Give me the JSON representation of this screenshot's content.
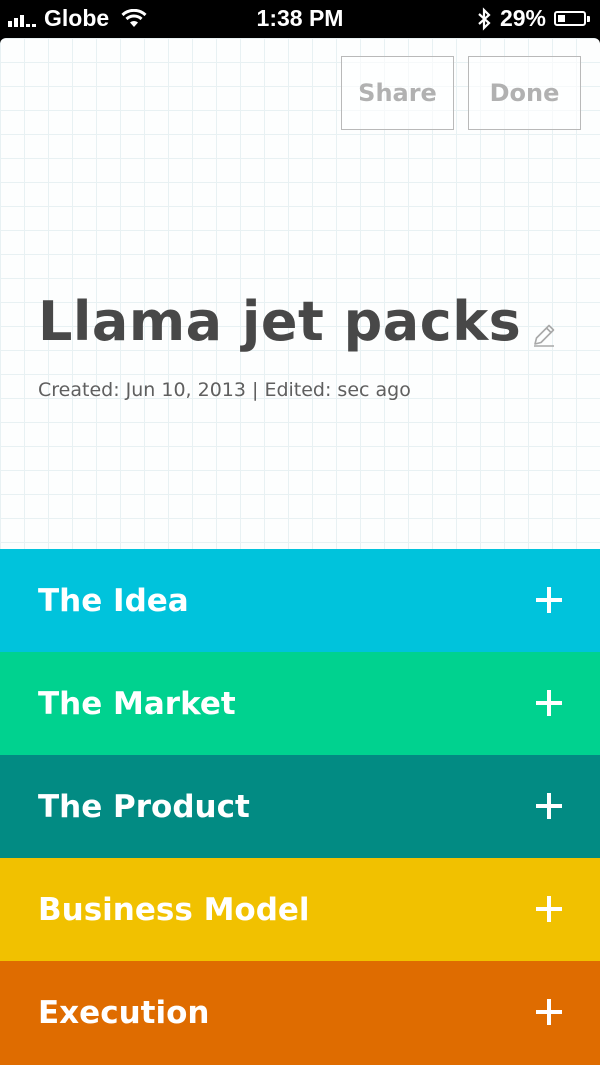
{
  "status_bar": {
    "carrier": "Globe",
    "time": "1:38 PM",
    "battery_percent": "29%",
    "battery_level": 0.29,
    "icons": [
      "signal-icon",
      "wifi-icon",
      "bluetooth-icon",
      "battery-icon"
    ]
  },
  "toolbar": {
    "share_label": "Share",
    "done_label": "Done"
  },
  "note": {
    "title": "Llama jet packs",
    "meta": "Created: Jun 10, 2013 | Edited: sec ago"
  },
  "sections": [
    {
      "label": "The Idea",
      "color": "#00c3dc"
    },
    {
      "label": "The Market",
      "color": "#00d28f"
    },
    {
      "label": "The Product",
      "color": "#028b83"
    },
    {
      "label": "Business Model",
      "color": "#f1c100"
    },
    {
      "label": "Execution",
      "color": "#df6c00"
    }
  ]
}
